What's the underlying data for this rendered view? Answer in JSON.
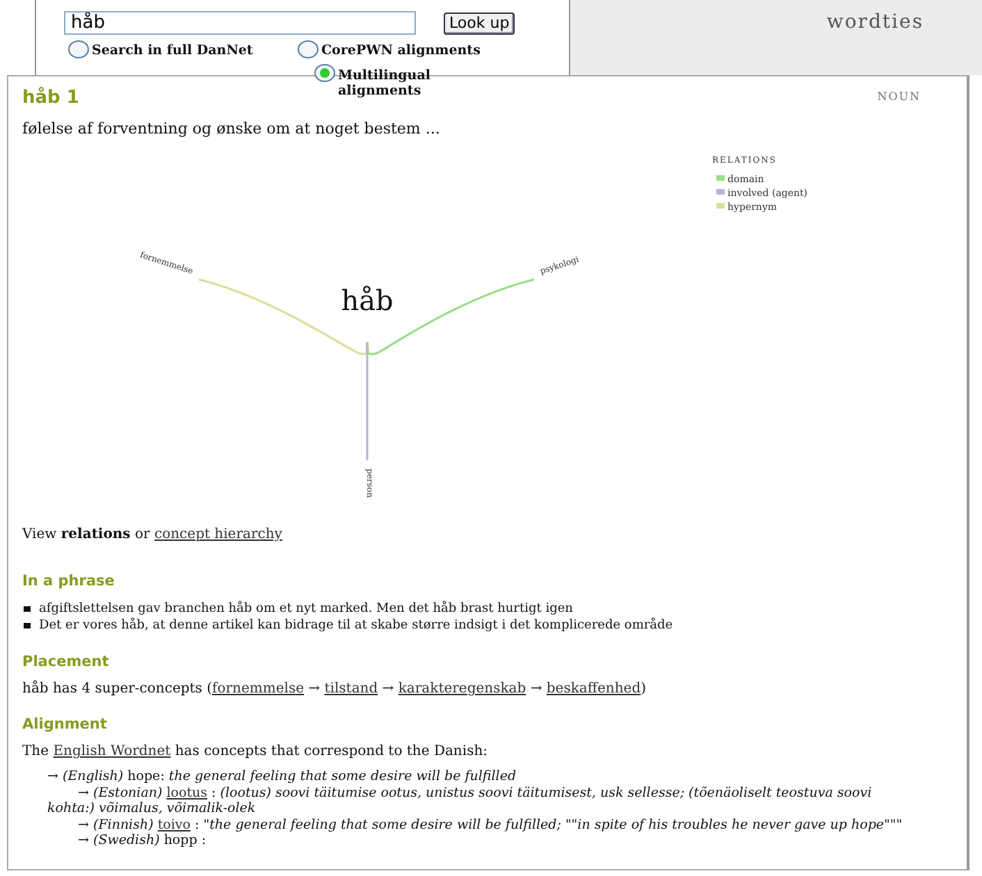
{
  "search": {
    "value": "håb",
    "button": "Look up"
  },
  "search_options": [
    {
      "label": "Search in full DanNet",
      "selected": false
    },
    {
      "label": "CorePWN alignments",
      "selected": false
    },
    {
      "label": "Multilingual alignments",
      "selected": true
    }
  ],
  "brand": "wordties",
  "entry": {
    "title": "håb 1",
    "pos": "NOUN",
    "definition": "følelse af forventning og ønske om at noget bestem ..."
  },
  "graph": {
    "center": "håb",
    "legend_title": "RELATIONS",
    "legend": [
      {
        "label": "domain",
        "color": "#99dd88"
      },
      {
        "label": "involved (agent)",
        "color": "#c0b0d8"
      },
      {
        "label": "hypernym",
        "color": "#dddd99"
      }
    ],
    "nodes": [
      {
        "label": "fornemmelse",
        "kind": "left",
        "color": "#dddd99"
      },
      {
        "label": "psykologi",
        "kind": "right",
        "color": "#99dd88"
      },
      {
        "label": "person",
        "kind": "down",
        "color": "#c0b0d8"
      }
    ]
  },
  "view_line": {
    "text": "View **relations** or ",
    "link": "concept hierarchy"
  },
  "phrases": {
    "heading": "In a phrase",
    "items": [
      "afgiftslettelsen gav branchen håb om et nyt marked. Men det håb brast hurtigt igen",
      "Det er vores håb, at denne artikel kan bidrage til at skabe større indsigt i det komplicerede område"
    ]
  },
  "placement": {
    "heading": "Placement",
    "prefix": "håb has 4 super-concepts (",
    "separator": "→",
    "links": [
      "fornemmelse",
      "tilstand",
      "karakteregenskab",
      "beskaffenhed"
    ],
    "suffix": ")"
  },
  "alignment": {
    "heading": "Alignment",
    "intro_prefix": "The ",
    "intro_link": "English Wordnet",
    "intro_suffix": " has concepts that correspond to the Danish:",
    "entries": [
      {
        "arrow": "→",
        "language": "(English)",
        "word": "hope",
        "linked": false,
        "sep": ":",
        "gloss": "the general feeling that some desire will be fulfilled",
        "children": [
          {
            "arrow": "→",
            "language": "(Estonian)",
            "word": "lootus",
            "linked": true,
            "sep": " : ",
            "gloss": "(lootus) soovi täitumise ootus, unistus soovi täitumisest, usk sellesse; (tõenäoliselt teostuva soovi kohta:) võimalus, võimalik-olek"
          },
          {
            "arrow": "→",
            "language": "(Finnish)",
            "word": "toivo",
            "linked": true,
            "sep": " : ",
            "gloss": "\"the general feeling that some desire will be fulfilled; \"\"in spite of his troubles he never gave up hope\"\"\""
          },
          {
            "arrow": "→",
            "language": "(Swedish)",
            "word": "hopp",
            "linked": false,
            "sep": " :"
          }
        ]
      }
    ]
  }
}
